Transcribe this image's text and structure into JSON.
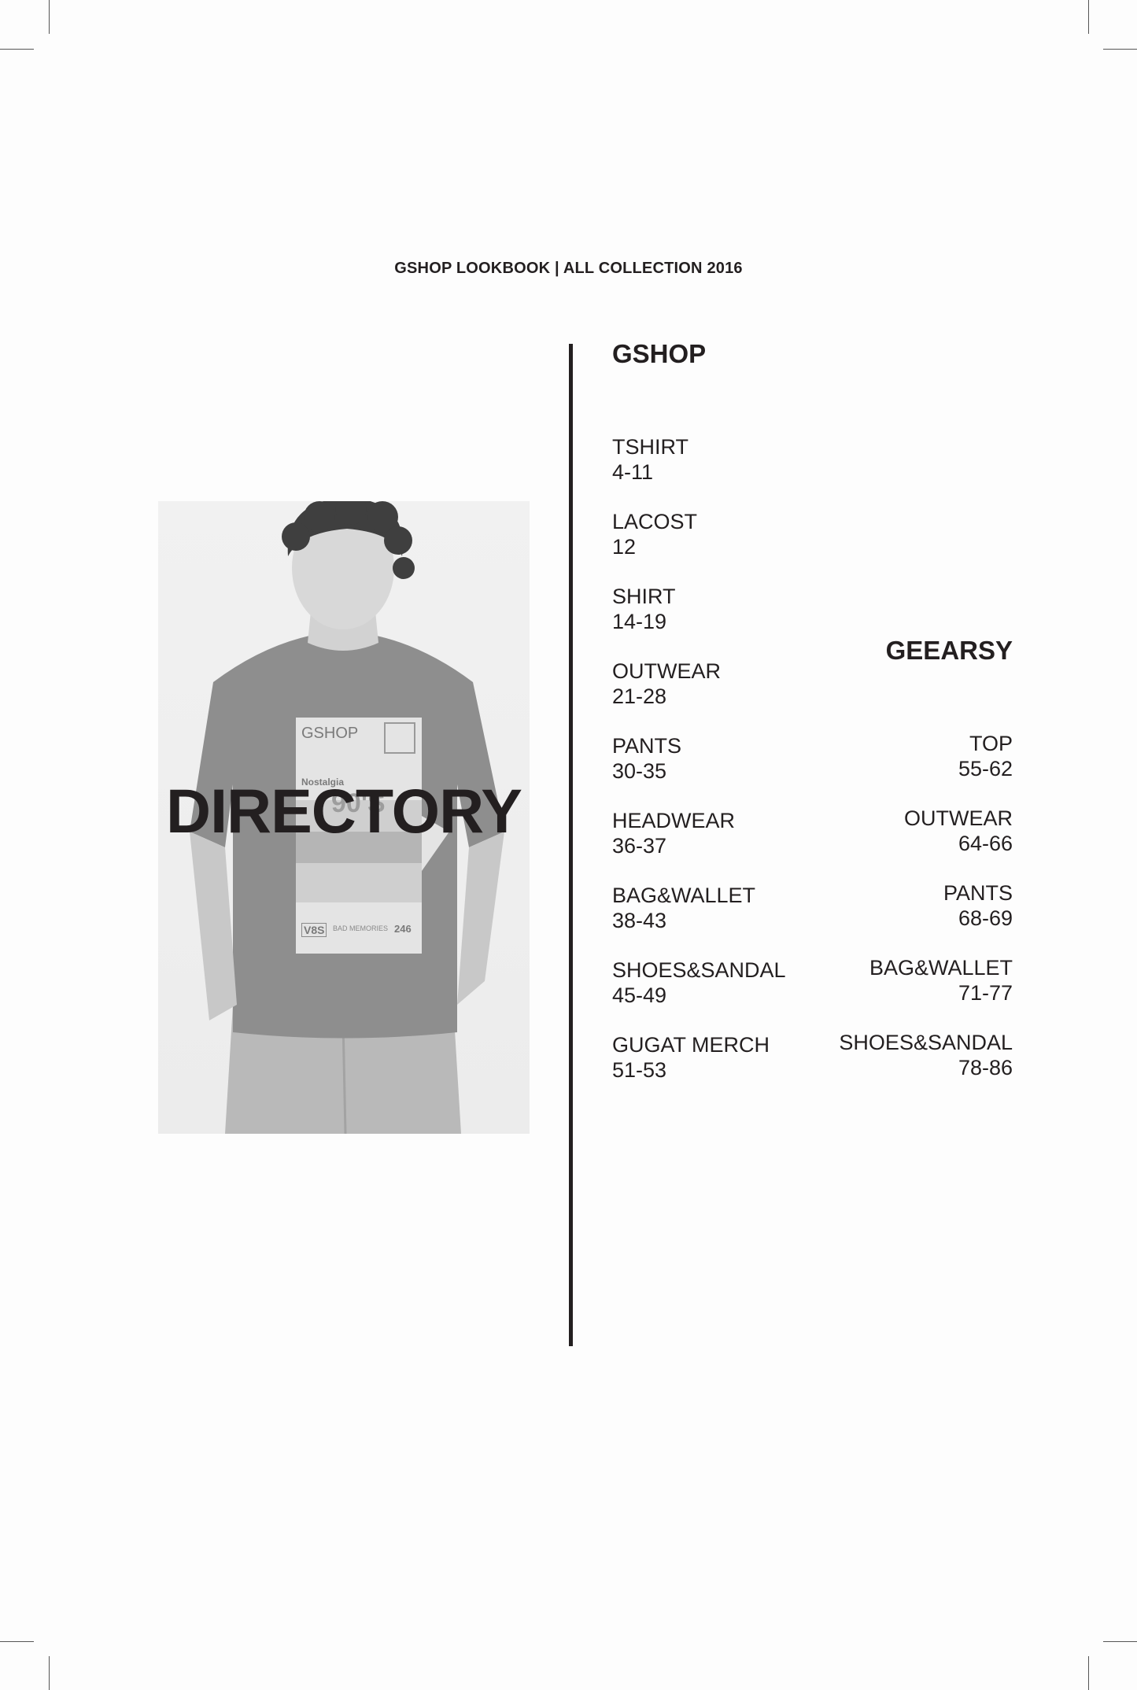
{
  "header": {
    "text": "GSHOP LOOKBOOK  |  ALL COLLECTION 2016"
  },
  "hero": {
    "title": "DIRECTORY",
    "shirt_print": {
      "brand": "GSHOP",
      "line1": "Nostalgia",
      "line2": "90'S",
      "tag": "V8S",
      "caption": "BAD MEMORIES",
      "number": "246"
    }
  },
  "gshop": {
    "title": "GSHOP",
    "items": [
      {
        "name": "TSHIRT",
        "pages": "4-11"
      },
      {
        "name": "LACOST",
        "pages": "12"
      },
      {
        "name": "SHIRT",
        "pages": "14-19"
      },
      {
        "name": "OUTWEAR",
        "pages": "21-28"
      },
      {
        "name": "PANTS",
        "pages": "30-35"
      },
      {
        "name": "HEADWEAR",
        "pages": "36-37"
      },
      {
        "name": "BAG&WALLET",
        "pages": "38-43"
      },
      {
        "name": "SHOES&SANDAL",
        "pages": "45-49"
      },
      {
        "name": "GUGAT MERCH",
        "pages": "51-53"
      }
    ]
  },
  "geearsy": {
    "title": "GEEARSY",
    "items": [
      {
        "name": "TOP",
        "pages": "55-62"
      },
      {
        "name": "OUTWEAR",
        "pages": "64-66"
      },
      {
        "name": "PANTS",
        "pages": "68-69"
      },
      {
        "name": "BAG&WALLET",
        "pages": "71-77"
      },
      {
        "name": "SHOES&SANDAL",
        "pages": "78-86"
      }
    ]
  },
  "colors": {
    "ink": "#231f20",
    "paper": "#fdfdfd",
    "photo_bg": "#efefef",
    "shirt": "#8e8e8e"
  }
}
